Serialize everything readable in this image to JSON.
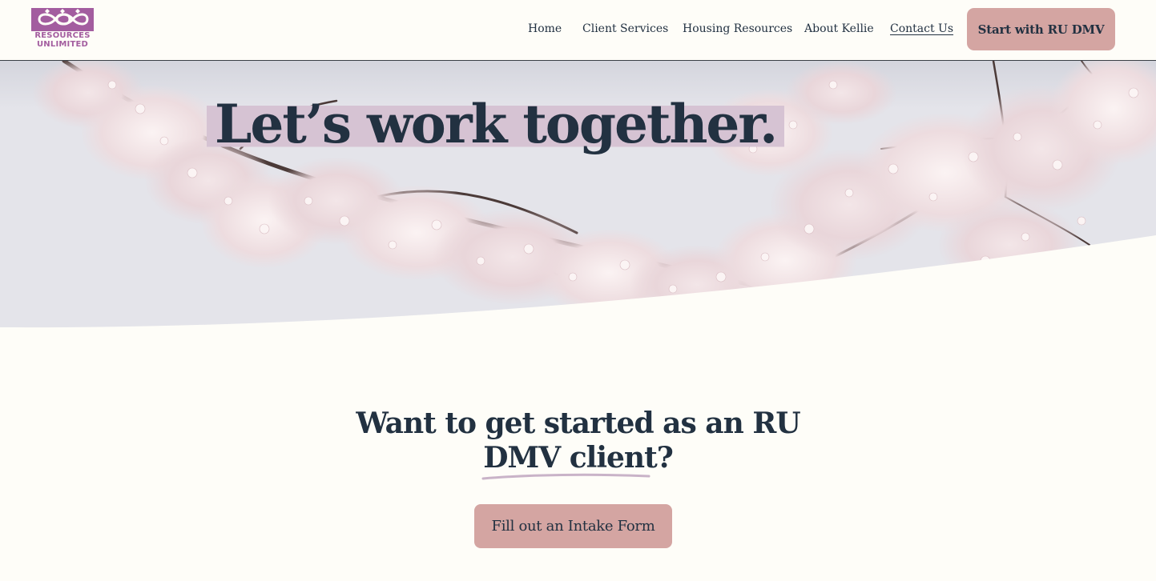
{
  "header": {
    "logo": {
      "line1": "RESOURCES",
      "line2": "UNLIMITED",
      "icon": "infinity-hearts-icon",
      "color": "#a35d9f"
    },
    "nav": [
      {
        "label": "Home"
      },
      {
        "label": "Client Services"
      },
      {
        "label": "Housing Resources"
      },
      {
        "label": "About Kellie"
      },
      {
        "label": "Contact Us",
        "current": true
      }
    ],
    "cta_label": "Start with RU DMV"
  },
  "hero": {
    "title": "Let’s work together.",
    "image": "cherry-blossom-branches-photo"
  },
  "intro": {
    "heading_line1": "Want to get started as an RU",
    "heading_line2": "DMV client?",
    "button_label": "Fill out an Intake Form"
  },
  "colors": {
    "background": "#fefdf8",
    "text": "#223141",
    "accent_button": "#d4a5a2",
    "title_highlight": "#d6c3d3",
    "underline": "#c9b3c8"
  }
}
